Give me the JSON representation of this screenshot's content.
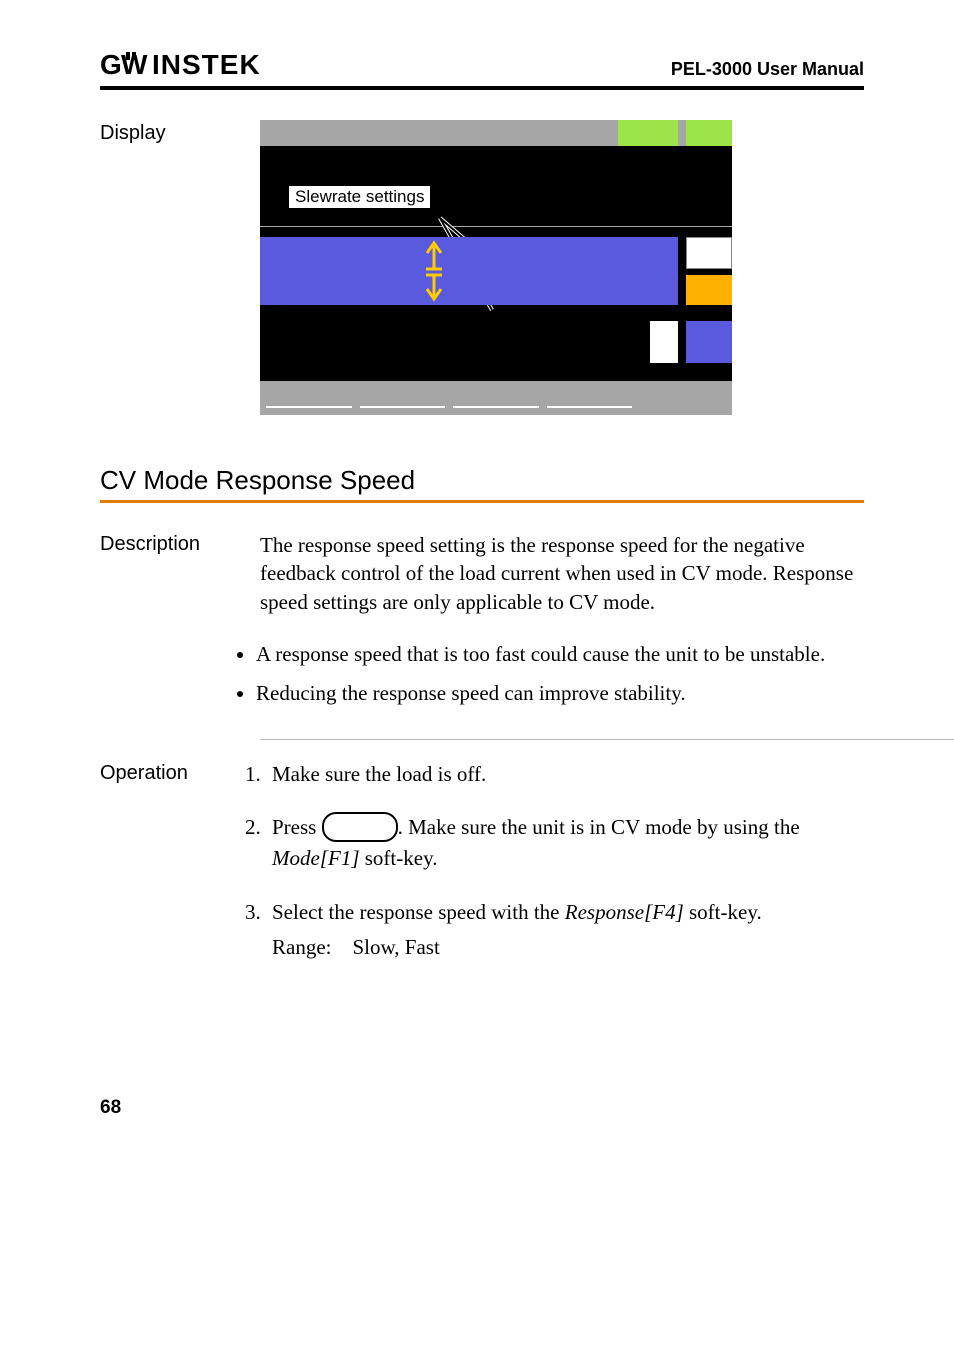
{
  "header": {
    "brand": "GWINSTEK",
    "manual": "PEL-3000 User Manual"
  },
  "display_section": {
    "label": "Display",
    "callout": "Slewrate settings"
  },
  "section": {
    "title": "CV Mode Response Speed"
  },
  "description": {
    "label": "Description",
    "para": "The response speed setting is the response speed for the negative feedback control of the load current when used in CV mode. Response speed settings are only applicable to CV mode.",
    "bullets": [
      "A response speed that is too fast could cause the unit to be unstable.",
      "Reducing the response speed can improve stability."
    ]
  },
  "operation": {
    "label": "Operation",
    "step1": "Make sure the load is off.",
    "step2_a": "Press ",
    "step2_b": ". Make sure the unit is in CV mode by using the ",
    "step2_sk": "Mode[F1]",
    "step2_c": " soft-key.",
    "step3_a": "Select the response speed with the ",
    "step3_sk": "Response[F4]",
    "step3_b": " soft-key.",
    "range_label": "Range:",
    "range_val": "Slow, Fast"
  },
  "page_number": "68"
}
